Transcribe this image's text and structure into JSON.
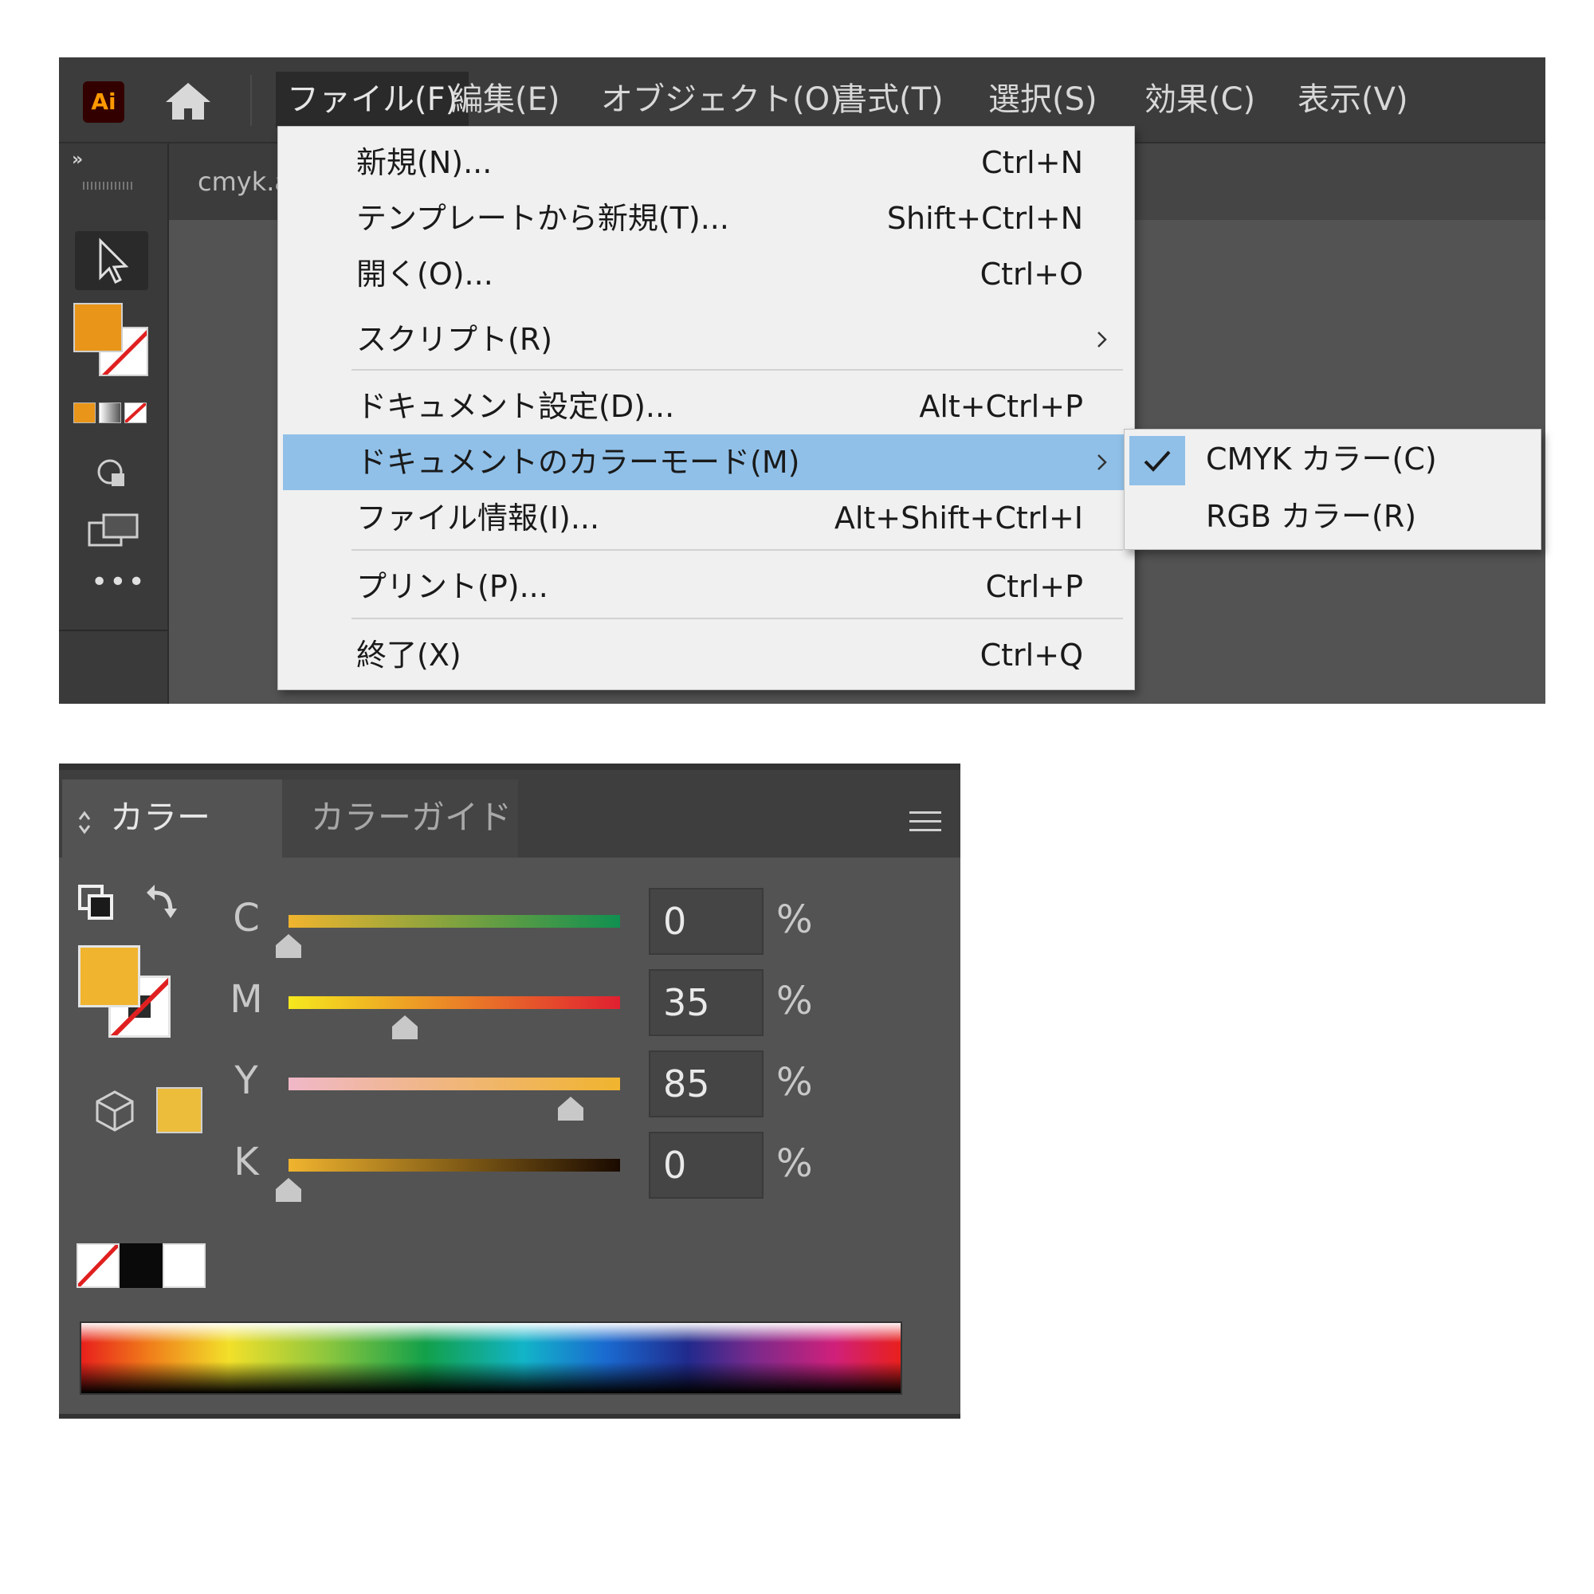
{
  "app": {
    "logo_text": "Ai",
    "menubar": [
      "ファイル(F)",
      "編集(E)",
      "オブジェクト(O)",
      "書式(T)",
      "選択(S)",
      "効果(C)",
      "表示(V)"
    ],
    "active_menu_index": 0,
    "doc_tab": "cmyk.a",
    "toolbar": {
      "collapse": "»",
      "more": "•••",
      "fill_color": "#e8951a"
    }
  },
  "file_menu": {
    "items": [
      {
        "label": "新規(N)...",
        "shortcut": "Ctrl+N"
      },
      {
        "label": "テンプレートから新規(T)...",
        "shortcut": "Shift+Ctrl+N"
      },
      {
        "label": "開く(O)...",
        "shortcut": "Ctrl+O"
      },
      {
        "label": "スクリプト(R)",
        "shortcut": "",
        "submenu": true
      },
      {
        "label": "ドキュメント設定(D)...",
        "shortcut": "Alt+Ctrl+P"
      },
      {
        "label": "ドキュメントのカラーモード(M)",
        "shortcut": "",
        "submenu": true,
        "highlighted": true
      },
      {
        "label": "ファイル情報(I)...",
        "shortcut": "Alt+Shift+Ctrl+I"
      },
      {
        "label": "プリント(P)...",
        "shortcut": "Ctrl+P"
      },
      {
        "label": "終了(X)",
        "shortcut": "Ctrl+Q"
      }
    ]
  },
  "color_mode_submenu": {
    "items": [
      {
        "label": "CMYK カラー(C)",
        "checked": true
      },
      {
        "label": "RGB カラー(R)",
        "checked": false
      }
    ]
  },
  "color_panel": {
    "tabs": [
      "カラー",
      "カラーガイド"
    ],
    "active_tab": 0,
    "fill_color": "#f0b42e",
    "gamut_color": "#ecbc3b",
    "channels": [
      {
        "label": "C",
        "value": "0",
        "unit": "%",
        "fraction": 0.0,
        "gradient": [
          "#f0b42e",
          "#109050"
        ]
      },
      {
        "label": "M",
        "value": "35",
        "unit": "%",
        "fraction": 0.35,
        "gradient": [
          "#f5e81e",
          "#e02030"
        ]
      },
      {
        "label": "Y",
        "value": "85",
        "unit": "%",
        "fraction": 0.85,
        "gradient": [
          "#f0b8c8",
          "#f0b42e"
        ]
      },
      {
        "label": "K",
        "value": "0",
        "unit": "%",
        "fraction": 0.0,
        "gradient": [
          "#f0b42e",
          "#1a0a00"
        ]
      }
    ],
    "quick_swatches": [
      "none",
      "#000000",
      "#ffffff"
    ]
  }
}
